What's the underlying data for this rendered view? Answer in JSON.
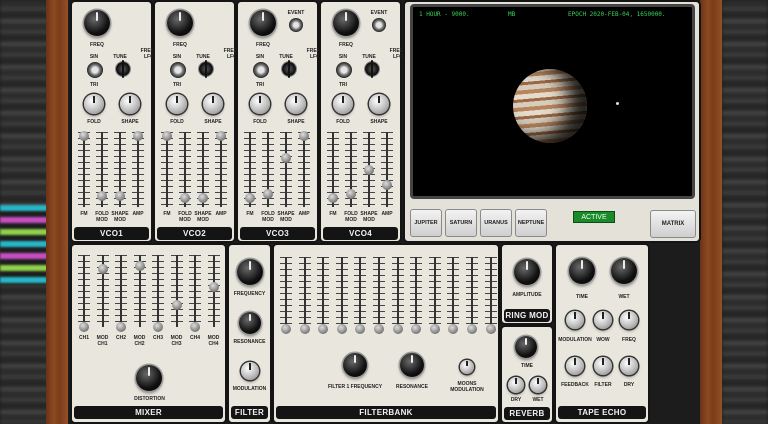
{
  "vco": [
    {
      "title": "VCO1",
      "labels": {
        "freq": "FREQ",
        "sin": "SIN",
        "tune": "TUNE",
        "free_lfo": "FREE\nLFO",
        "tri": "TRI",
        "fold": "FOLD",
        "shape": "SHAPE"
      },
      "sliders": [
        "FM",
        "FOLD\nMOD",
        "SHAPE\nMOD",
        "AMP"
      ],
      "event": ""
    },
    {
      "title": "VCO2",
      "labels": {
        "freq": "FREQ",
        "sin": "SIN",
        "tune": "TUNE",
        "free_lfo": "FREE\nLFO",
        "tri": "TRI",
        "fold": "FOLD",
        "shape": "SHAPE"
      },
      "sliders": [
        "FM",
        "FOLD\nMOD",
        "SHAPE\nMOD",
        "AMP"
      ],
      "event": ""
    },
    {
      "title": "VCO3",
      "labels": {
        "freq": "FREQ",
        "sin": "SIN",
        "tune": "TUNE",
        "free_lfo": "FREE\nLFO",
        "tri": "TRI",
        "fold": "FOLD",
        "shape": "SHAPE"
      },
      "sliders": [
        "FM",
        "FOLD\nMOD",
        "SHAPE\nMOD",
        "AMP"
      ],
      "event": "EVENT"
    },
    {
      "title": "VCO4",
      "labels": {
        "freq": "FREQ",
        "sin": "SIN",
        "tune": "TUNE",
        "free_lfo": "FREE\nLFO",
        "tri": "TRI",
        "fold": "FOLD",
        "shape": "SHAPE"
      },
      "sliders": [
        "FM",
        "FOLD\nMOD",
        "SHAPE\nMOD",
        "AMP"
      ],
      "event": "EVENT"
    }
  ],
  "slider_levels": [
    [
      0.05,
      0.85,
      0.85,
      0.05
    ],
    [
      0.05,
      0.88,
      0.88,
      0.05
    ],
    [
      0.88,
      0.82,
      0.35,
      0.05
    ],
    [
      0.88,
      0.82,
      0.5,
      0.7
    ]
  ],
  "screen": {
    "hour": "1 HOUR - 9000.",
    "mb": "MB",
    "epoch": "EPOCH 2020-FEB-04, 1650000."
  },
  "planets": [
    "JUPITER",
    "SATURN",
    "URANUS",
    "NEPTUNE"
  ],
  "active": "ACTIVE",
  "matrix": "MATRIX",
  "mixer": {
    "title": "MIXER",
    "sliders": [
      "CH1",
      "MOD\nCH1",
      "CH2",
      "MOD\nCH2",
      "CH3",
      "MOD\nCH3",
      "CH4",
      "MOD\nCH4"
    ],
    "levels": [
      0.0,
      0.8,
      0.0,
      0.85,
      0.0,
      0.3,
      0.0,
      0.55
    ],
    "distortion": "DISTORTION"
  },
  "filter": {
    "title": "FILTER",
    "frequency": "FREQUENCY",
    "resonance": "RESONANCE",
    "modulation": "MODULATION"
  },
  "filterbank": {
    "title": "FILTERBANK",
    "count": 12,
    "freq": "FILTER 1 FREQUENCY",
    "res": "RESONANCE",
    "moog": "MOONS\nMODULATION"
  },
  "ringmod": {
    "title": "RING MOD",
    "amplitude": "AMPLITUDE"
  },
  "reverb": {
    "title": "REVERB",
    "time": "TIME",
    "dry": "DRY",
    "wet": "WET"
  },
  "tape": {
    "title": "TAPE ECHO",
    "time": "TIME",
    "wet": "WET",
    "modulation": "MODULATION",
    "wow": "WOW",
    "freq": "FREQ",
    "feedback": "FEEDBACK",
    "filter": "FILTER",
    "dry": "DRY"
  },
  "colors": {
    "active": "#1a8a2a",
    "screen_text": "#38d45a",
    "panel": "#e9e6dd"
  }
}
